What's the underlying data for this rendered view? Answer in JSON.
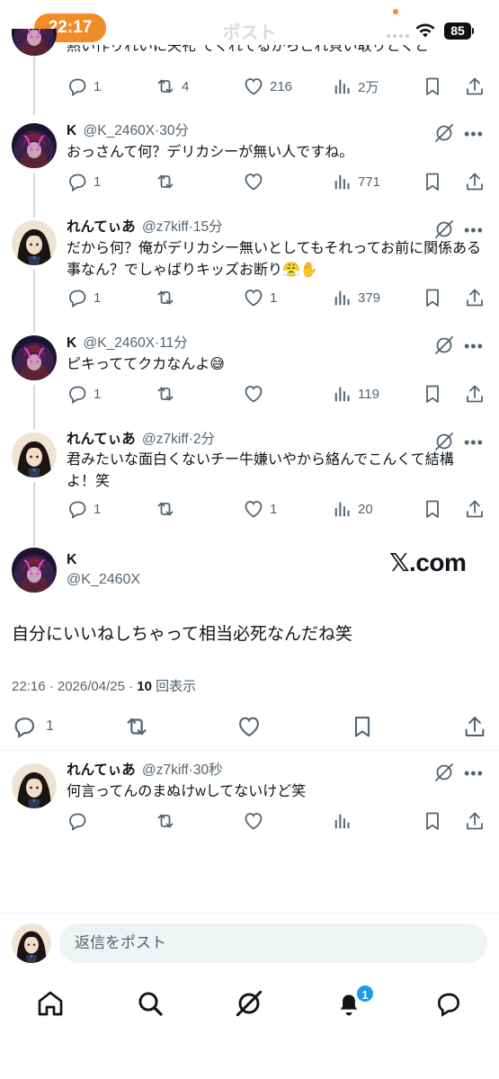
{
  "status_bar": {
    "time": "22:17",
    "battery": "85"
  },
  "header": {
    "title": "ポスト"
  },
  "thread": {
    "cut_text": "黙い作りれいに失礼 てくれてるからこれ貝い取りとくと",
    "cut_tweet_stats": {
      "replies": "1",
      "reposts": "4",
      "likes": "216",
      "views": "2万"
    },
    "tweets": [
      {
        "name": "K",
        "handle": "@K_2460X",
        "time": "30分",
        "text": "おっさんて何？デリカシーが無い人ですね。",
        "replies": "1",
        "reposts": "",
        "likes": "",
        "views": "771"
      },
      {
        "name": "れんてぃあ",
        "handle": "@z7kiff",
        "time": "15分",
        "text": "だから何？俺がデリカシー無いとしてもそれってお前に関係ある事なん？でしゃばりキッズお断り😤✋",
        "replies": "1",
        "reposts": "",
        "likes": "1",
        "views": "379"
      },
      {
        "name": "K",
        "handle": "@K_2460X",
        "time": "11分",
        "text": "ピキっててクカなんよ😅",
        "replies": "1",
        "reposts": "",
        "likes": "",
        "views": "119"
      },
      {
        "name": "れんてぃあ",
        "handle": "@z7kiff",
        "time": "2分",
        "text": "君みたいな面白くないチー牛嫌いやから絡んでこんくて結構よ！笑",
        "replies": "1",
        "reposts": "",
        "likes": "1",
        "views": "20"
      }
    ]
  },
  "main_tweet": {
    "name": "K",
    "handle": "@K_2460X",
    "watermark": "𝕏.com",
    "text": "自分にいいねしちゃって相当必死なんだね笑",
    "timestamp": "22:16 · 2026/04/25 · ",
    "view_count": "10",
    "view_label": " 回表示",
    "replies": "1"
  },
  "reply": {
    "name": "れんてぃあ",
    "handle": "@z7kiff",
    "time": "30秒",
    "text": "何言ってんのまぬけwしてないけど笑"
  },
  "compose": {
    "placeholder": "返信をポスト"
  },
  "tabbar": {
    "notifications_badge": "1"
  },
  "colors": {
    "accent": "#1d9bf0",
    "status_pill": "#f28c28",
    "muted": "#536471"
  }
}
